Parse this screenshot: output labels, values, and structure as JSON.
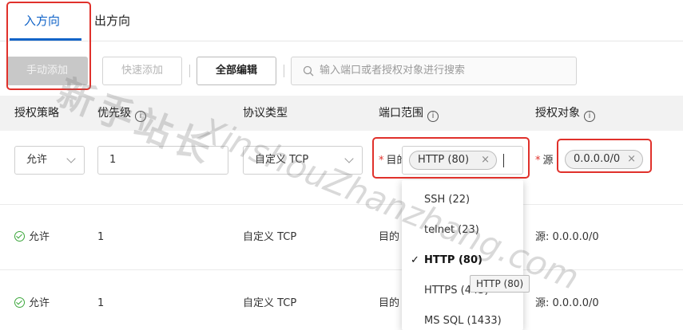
{
  "tabs": {
    "inbound": "入方向",
    "outbound": "出方向"
  },
  "toolbar": {
    "manual_add": "手动添加",
    "quick_add": "快速添加",
    "edit_all": "全部编辑",
    "search_placeholder": "输入端口或者授权对象进行搜索"
  },
  "table": {
    "headers": {
      "policy": "授权策略",
      "priority": "优先级",
      "protocol": "协议类型",
      "port_range": "端口范围",
      "auth_object": "授权对象"
    },
    "info_glyph": "i",
    "edit_row": {
      "policy": "允许",
      "priority": "1",
      "protocol": "自定义 TCP",
      "port_label": "目的",
      "port_tag": "HTTP (80)",
      "source_label": "源",
      "source_tag": "0.0.0.0/0",
      "remove_glyph": "×"
    },
    "rows": [
      {
        "policy": "允许",
        "priority": "1",
        "protocol": "自定义 TCP",
        "port": "目的",
        "source": "源: 0.0.0.0/0"
      },
      {
        "policy": "允许",
        "priority": "1",
        "protocol": "自定义 TCP",
        "port": "目的",
        "source": "源: 0.0.0.0/0"
      }
    ]
  },
  "dropdown": {
    "options": [
      {
        "label": "SSH (22)",
        "selected": false
      },
      {
        "label": "telnet (23)",
        "selected": false
      },
      {
        "label": "HTTP (80)",
        "selected": true
      },
      {
        "label": "HTTPS (443)",
        "selected": false
      },
      {
        "label": "MS SQL (1433)",
        "selected": false
      }
    ],
    "check_glyph": "✓",
    "tooltip": "HTTP (80)"
  },
  "watermark": {
    "cn": "新手站长",
    "en": "XinshouZhanzhang.com"
  },
  "colors": {
    "accent": "#1264c8",
    "highlight": "#e0312b",
    "success": "#3aa63a"
  }
}
